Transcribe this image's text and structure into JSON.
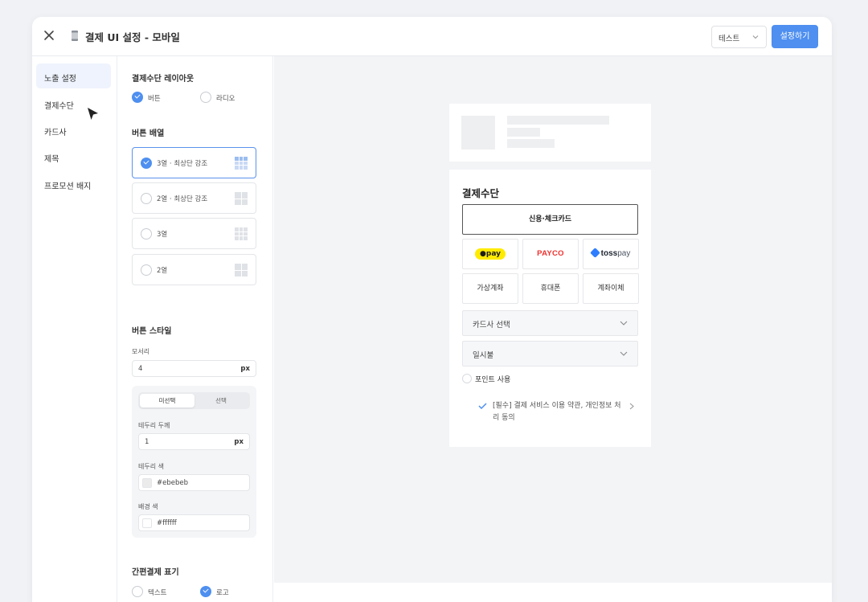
{
  "header": {
    "title": "결제 UI 설정 - 모바일",
    "env_select": "테스트",
    "apply_label": "설정하기"
  },
  "sidebar": {
    "items": [
      {
        "label": "노출 설정",
        "active": true
      },
      {
        "label": "결제수단",
        "active": false
      },
      {
        "label": "카드사",
        "active": false
      },
      {
        "label": "제목",
        "active": false
      },
      {
        "label": "프로모션 배지",
        "active": false
      }
    ]
  },
  "settings": {
    "layout": {
      "title": "결제수단 레이아웃",
      "options": [
        {
          "label": "버튼",
          "checked": true
        },
        {
          "label": "라디오",
          "checked": false
        }
      ]
    },
    "arrangement": {
      "title": "버튼 배열",
      "options": [
        {
          "label": "3열 · 최상단 강조",
          "checked": true
        },
        {
          "label": "2열 · 최상단 강조",
          "checked": false
        },
        {
          "label": "3열",
          "checked": false
        },
        {
          "label": "2열",
          "checked": false
        }
      ]
    },
    "style": {
      "title": "버튼 스타일",
      "radius_label": "모서리",
      "radius_value": "4",
      "unit": "px",
      "tabs": [
        "미선택",
        "선택"
      ],
      "border_width_label": "테두리 두께",
      "border_width_value": "1",
      "border_color_label": "테두리 색",
      "border_color_value": "#ebebeb",
      "bg_color_label": "배경 색",
      "bg_color_value": "#ffffff"
    },
    "easy_pay": {
      "title": "간편결제 표기",
      "options": [
        {
          "label": "텍스트",
          "checked": false
        },
        {
          "label": "로고",
          "checked": true
        }
      ]
    }
  },
  "preview": {
    "title": "결제수단",
    "primary_button": "신용·체크카드",
    "easy_pay": {
      "kakao": "pay",
      "payco": "PAYCO",
      "toss_a": "toss",
      "toss_b": "pay"
    },
    "methods": [
      "가상계좌",
      "휴대폰",
      "계좌이체"
    ],
    "card_select": "카드사 선택",
    "installment": "일시불",
    "point_label": "포인트 사용",
    "agreement": "[필수] 결제 서비스 이용 약관, 개인정보 처리 동의"
  },
  "colors": {
    "accent": "#4e8ff0",
    "kakao_yellow": "#ffeb00",
    "payco_red": "#f0312e",
    "toss_blue": "#2f7dff"
  }
}
